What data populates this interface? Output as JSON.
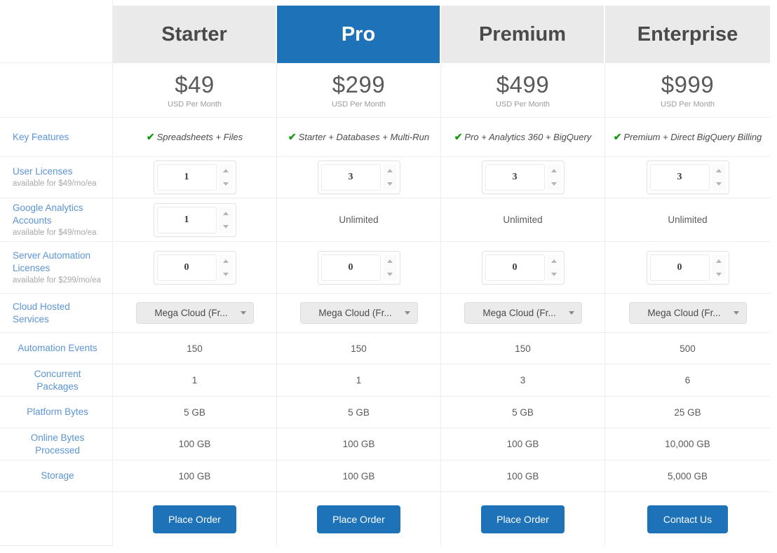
{
  "tiers": [
    {
      "name": "Starter",
      "price": "$49",
      "period": "USD Per Month",
      "highlight": false
    },
    {
      "name": "Pro",
      "price": "$299",
      "period": "USD Per Month",
      "highlight": true
    },
    {
      "name": "Premium",
      "price": "$499",
      "period": "USD Per Month",
      "highlight": false
    },
    {
      "name": "Enterprise",
      "price": "$999",
      "period": "USD Per Month",
      "highlight": false
    }
  ],
  "rows": {
    "key_features": {
      "label": "Key Features",
      "values": [
        "Spreadsheets + Files",
        "Starter + Databases + Multi-Run",
        "Pro + Analytics 360 + BigQuery",
        "Premium + Direct BigQuery Billing"
      ],
      "check_icon": "check-icon"
    },
    "user_licenses": {
      "label": "User Licenses",
      "sub": "available for $49/mo/ea",
      "values": [
        "1",
        "3",
        "3",
        "3"
      ]
    },
    "ga_accounts": {
      "label": "Google Analytics Accounts",
      "sub": "available for $49/mo/ea",
      "values": [
        "1",
        "Unlimited",
        "Unlimited",
        "Unlimited"
      ]
    },
    "server_automation": {
      "label": "Server Automation Licenses",
      "sub": "available for $299/mo/ea",
      "values": [
        "0",
        "0",
        "0",
        "0"
      ]
    },
    "cloud_hosted": {
      "label": "Cloud Hosted Services",
      "values": [
        "Mega Cloud (Fr...",
        "Mega Cloud (Fr...",
        "Mega Cloud (Fr...",
        "Mega Cloud (Fr..."
      ]
    },
    "automation_events": {
      "label": "Automation Events",
      "values": [
        "150",
        "150",
        "150",
        "500"
      ]
    },
    "concurrent_packages": {
      "label": "Concurrent Packages",
      "values": [
        "1",
        "1",
        "3",
        "6"
      ]
    },
    "platform_bytes": {
      "label": "Platform Bytes",
      "values": [
        "5 GB",
        "5 GB",
        "5 GB",
        "25 GB"
      ]
    },
    "online_bytes": {
      "label": "Online Bytes Processed",
      "values": [
        "100 GB",
        "100 GB",
        "100 GB",
        "10,000 GB"
      ]
    },
    "storage": {
      "label": "Storage",
      "values": [
        "100 GB",
        "100 GB",
        "100 GB",
        "5,000 GB"
      ]
    },
    "cta": {
      "values": [
        "Place Order",
        "Place Order",
        "Place Order",
        "Contact Us"
      ]
    }
  },
  "icons": {
    "check": "✔",
    "spinner_up": "spinner-up-icon",
    "spinner_down": "spinner-down-icon",
    "caret": "chevron-down-icon"
  },
  "colors": {
    "accent": "#1d72b8",
    "header_bg": "#eaeaea",
    "check_green": "#139c13",
    "label_link": "#5b94d6"
  }
}
